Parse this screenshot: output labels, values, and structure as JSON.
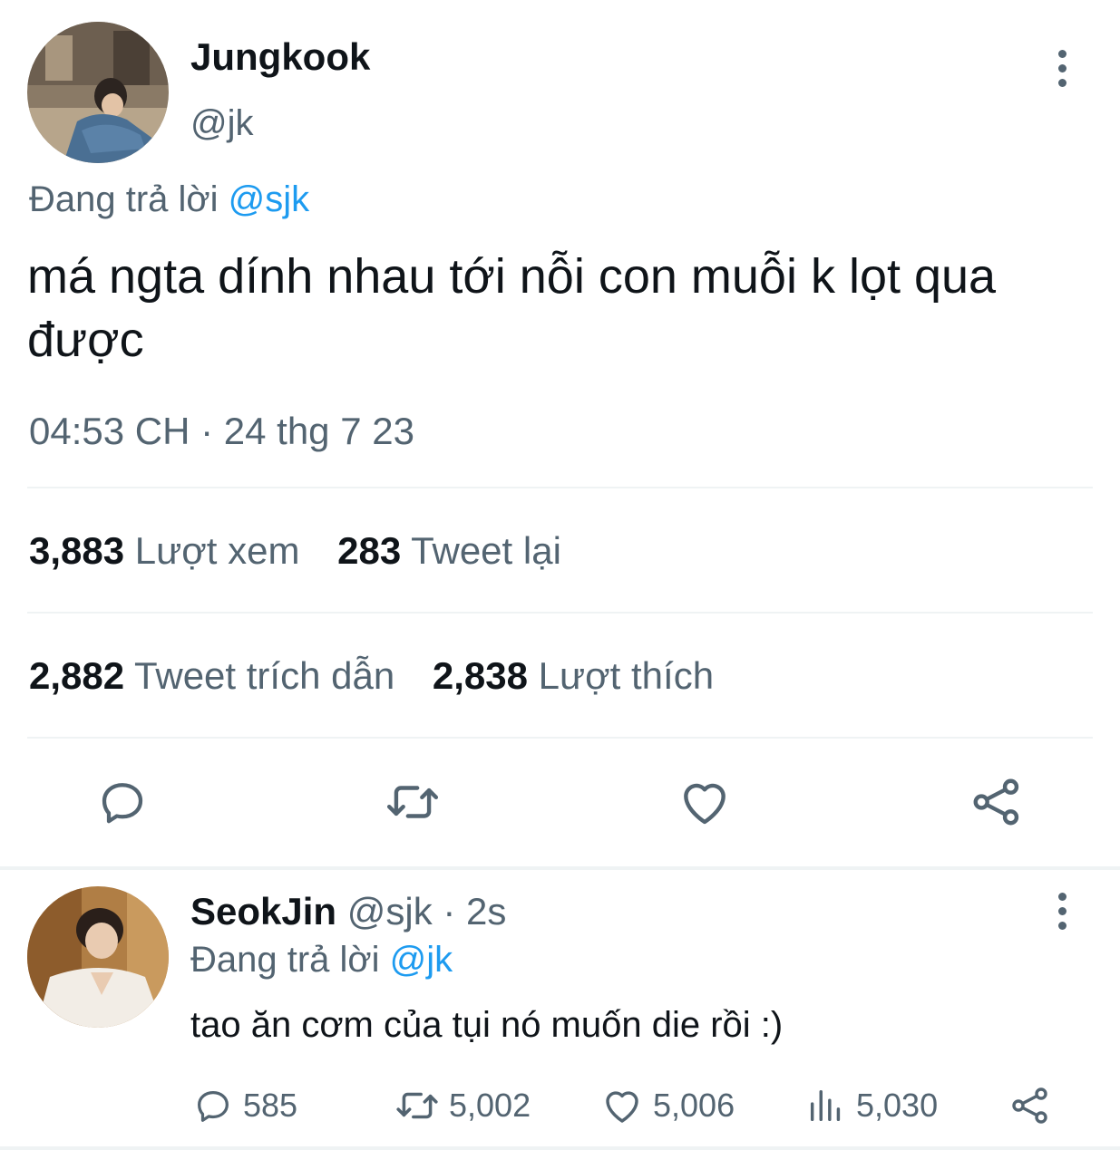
{
  "main_tweet": {
    "author_name": "Jungkook",
    "author_handle": "@jk",
    "replying_prefix": "Đang trả lời ",
    "replying_to": "@sjk",
    "text": "má ngta dính nhau tới nỗi con muỗi k lọt qua được",
    "timestamp": "04:53 CH · 24 thg 7 23",
    "stats": {
      "views_count": "3,883",
      "views_label": "Lượt xem",
      "retweets_count": "283",
      "retweets_label": "Tweet lại",
      "quotes_count": "2,882",
      "quotes_label": "Tweet trích dẫn",
      "likes_count": "2,838",
      "likes_label": "Lượt thích"
    },
    "actions": [
      "reply-icon",
      "retweet-icon",
      "like-icon",
      "share-icon"
    ]
  },
  "reply_tweet": {
    "author_name": "SeokJin",
    "author_handle": "@sjk",
    "time_ago": "· 2s",
    "replying_prefix": "Đang trả lời ",
    "replying_to": "@jk",
    "text": "tao ăn cơm của tụi nó muốn die rồi :)",
    "counts": {
      "replies": "585",
      "retweets": "5,002",
      "likes": "5,006",
      "views": "5,030"
    }
  },
  "colors": {
    "text_primary": "#0f1419",
    "text_secondary": "#536471",
    "link": "#1d9bf0",
    "divider": "#eff3f4"
  }
}
